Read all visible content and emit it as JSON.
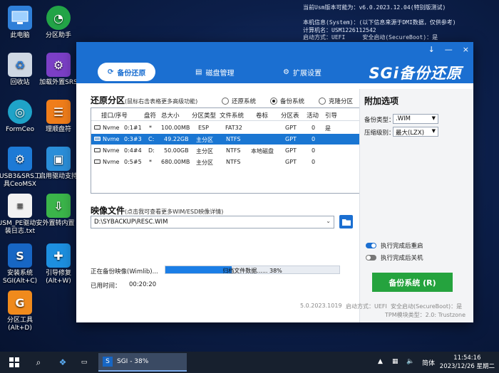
{
  "desktop": {
    "icons": [
      {
        "label": "此电脑",
        "icon": "computer-icon"
      },
      {
        "label": "分区助手",
        "icon": "partition-assistant-icon"
      },
      {
        "label": "回收站",
        "icon": "recycle-bin-icon"
      },
      {
        "label": "加载外置SRS",
        "icon": "load-srs-icon"
      },
      {
        "label": "FormCeo",
        "icon": "formceo-icon"
      },
      {
        "label": "理顺盘符",
        "icon": "drive-letter-icon"
      },
      {
        "label": "USB3&SRS工具CeoMSX",
        "icon": "usb-tool-icon"
      },
      {
        "label": "启用驱动支持",
        "icon": "driver-support-icon"
      },
      {
        "label": "USM_PE驱动安装日志.txt",
        "icon": "text-file-icon"
      },
      {
        "label": "外置转内置",
        "icon": "external-to-internal-icon"
      },
      {
        "label": "安装系统SGI(Alt+C)",
        "icon": "sgi-install-icon"
      },
      {
        "label": "引导修复(Alt+W)",
        "icon": "boot-repair-icon"
      },
      {
        "label": "分区工具(Alt+D)",
        "icon": "partition-tool-icon"
      }
    ],
    "sysinfo": "当前Usm版本可能为：v6.0.2023.12.04(特别版测试)\n\n本机信息(System)：(以下信息来源于DMI数据，仅供参考)\n计算机名：USM1226112542\n启动方式：UEFI     安全启动(SecureBoot)：是\n制造商：VMware, Inc\n产品名称：VMware..."
  },
  "window": {
    "controls": [
      "↓",
      "—",
      "×"
    ],
    "tabs": [
      {
        "label": "备份还原",
        "icon": "restore-icon",
        "active": true
      },
      {
        "label": "磁盘管理",
        "icon": "disk-manage-icon",
        "active": false
      },
      {
        "label": "扩展设置",
        "icon": "gear-icon",
        "active": false
      }
    ],
    "brand": "SGi备份还原"
  },
  "partition": {
    "title": "还原分区",
    "hint": "(鼠标右击表格更多高级功能)",
    "modes": [
      {
        "label": "还原系统",
        "checked": false
      },
      {
        "label": "备份系统",
        "checked": true
      },
      {
        "label": "克隆分区",
        "checked": false
      }
    ],
    "columns": [
      "接口/序号",
      "盘符",
      "总大小",
      "分区类型",
      "文件系统",
      "卷标",
      "分区表",
      "活动",
      "引导"
    ],
    "rows": [
      {
        "iface": "Nvme",
        "idx": "0:1#1",
        "drive": "*",
        "size": "100.00MB",
        "ptype": "ESP",
        "fs": "FAT32",
        "label": "",
        "table": "GPT",
        "active": "0",
        "boot": "是",
        "selected": false
      },
      {
        "iface": "Nvme",
        "idx": "0:3#3",
        "drive": "C:",
        "size": "49.22GB",
        "ptype": "主分区",
        "fs": "NTFS",
        "label": "",
        "table": "GPT",
        "active": "0",
        "boot": "",
        "selected": true
      },
      {
        "iface": "Nvme",
        "idx": "0:4#4",
        "drive": "D:",
        "size": "50.00GB",
        "ptype": "主分区",
        "fs": "NTFS",
        "label": "本地磁盘",
        "table": "GPT",
        "active": "0",
        "boot": "",
        "selected": false
      },
      {
        "iface": "Nvme",
        "idx": "0:5#5",
        "drive": "*",
        "size": "680.00MB",
        "ptype": "主分区",
        "fs": "NTFS",
        "label": "",
        "table": "GPT",
        "active": "0",
        "boot": "",
        "selected": false
      }
    ]
  },
  "image_file": {
    "title": "映像文件",
    "hint": "(点击我可查看更多WIM/ESD映像详情)",
    "path": "D:\\SYBACKUP\\RESC.WIM"
  },
  "progress": {
    "label": "正在备份映像(Wimlib)...",
    "text": "归档文件数据...... 38%",
    "percent": 38,
    "elapsed_label": "已用时间：",
    "elapsed_value": "00:20:20"
  },
  "options": {
    "title": "附加选项",
    "type_label": "备份类型：",
    "type_value": ".WIM",
    "level_label": "压缩级别：",
    "level_value": "最大(LZX)",
    "reboot_label": "执行完成后重启",
    "reboot_on": true,
    "shutdown_label": "执行完成后关机",
    "shutdown_on": false,
    "backup_button": "备份系统 (R)"
  },
  "footer": {
    "version": "5.0.2023.1019",
    "boot": "启动方式：UEFI",
    "secure": "安全启动(SecureBoot)：是",
    "tpm": "TPM模块类型：2.0: Trustzone"
  },
  "taskbar": {
    "app_label": "SGI - 38%",
    "ime": "简体",
    "time": "11:54:16",
    "date": "2023/12/26 星期二"
  }
}
